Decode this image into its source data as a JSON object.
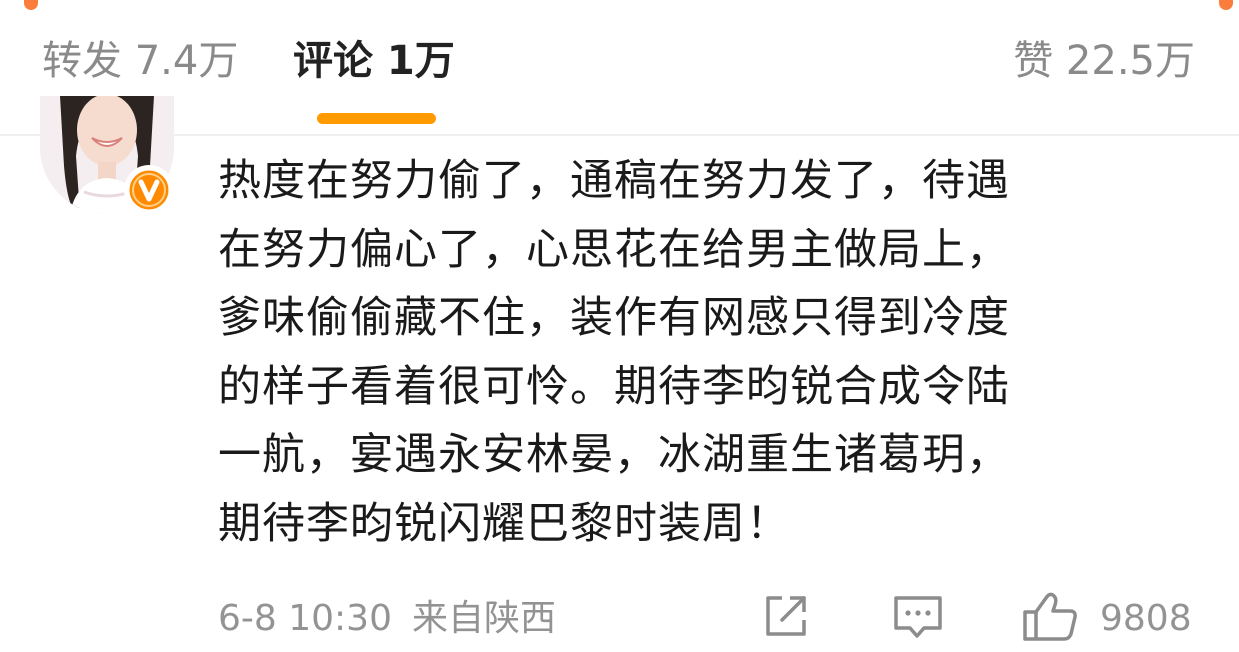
{
  "tabs": {
    "repost": "转发 7.4万",
    "comment": "评论 1万",
    "like": "赞 22.5万"
  },
  "comment": {
    "lines": [
      "热度在努力偷了，通稿在努力发了，待遇",
      "在努力偏心了，心思花在给男主做局上，",
      "爹味偷偷藏不住，装作有网感只得到冷度",
      "的样子看着很可怜。期待李昀锐合成令陆",
      "一航，宴遇永安林晏，冰湖重生诸葛玥，",
      "期待李昀锐闪耀巴黎时装周！"
    ],
    "date": "6-8 10:30",
    "location": "来自陕西",
    "like_count": "9808"
  },
  "icons": {
    "verified": "verified-v-badge-icon",
    "share": "share-icon",
    "reply": "comment-icon",
    "like": "thumbs-up-icon"
  },
  "colors": {
    "accent": "#ff9a00",
    "badge": "#ff8200",
    "text": "#1a1a1a",
    "secondary": "#939393"
  }
}
